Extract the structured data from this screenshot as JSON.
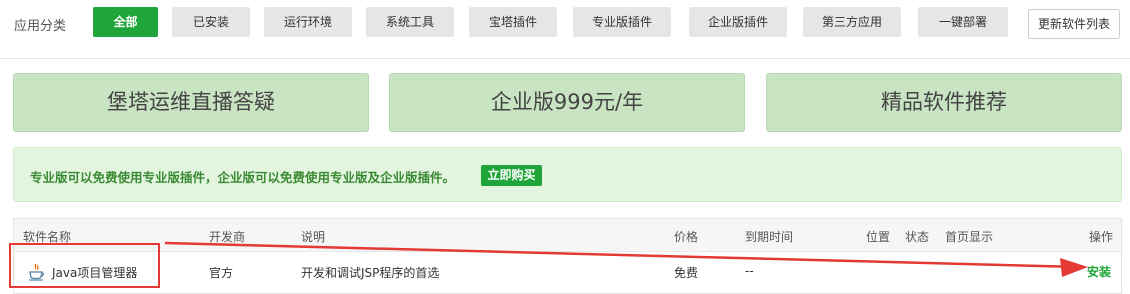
{
  "category_bar": {
    "label": "应用分类",
    "buttons": [
      "全部",
      "已安装",
      "运行环境",
      "系统工具",
      "宝塔插件",
      "专业版插件",
      "企业版插件",
      "第三方应用",
      "一键部署"
    ],
    "active_index": 0,
    "refresh_label": "更新软件列表"
  },
  "banners": [
    "堡塔运维直播答疑",
    "企业版999元/年",
    "精品软件推荐"
  ],
  "promo": {
    "text": "专业版可以免费使用专业版插件，企业版可以免费使用专业版及企业版插件。",
    "buy_label": "立即购买"
  },
  "table": {
    "headers": {
      "name": "软件名称",
      "developer": "开发商",
      "description": "说明",
      "price": "价格",
      "expire": "到期时间",
      "position": "位置",
      "status": "状态",
      "homepage": "首页显示",
      "action": "操作"
    },
    "rows": [
      {
        "icon": "java-icon",
        "name": "Java项目管理器",
        "developer": "官方",
        "description": "开发和调试JSP程序的首选",
        "price": "免费",
        "expire": "--",
        "action": "安装"
      }
    ]
  },
  "colors": {
    "accent": "#20a53a",
    "banner_bg": "#c9e4c3",
    "promo_bg": "#e3f5df",
    "annotation": "#e53935"
  }
}
